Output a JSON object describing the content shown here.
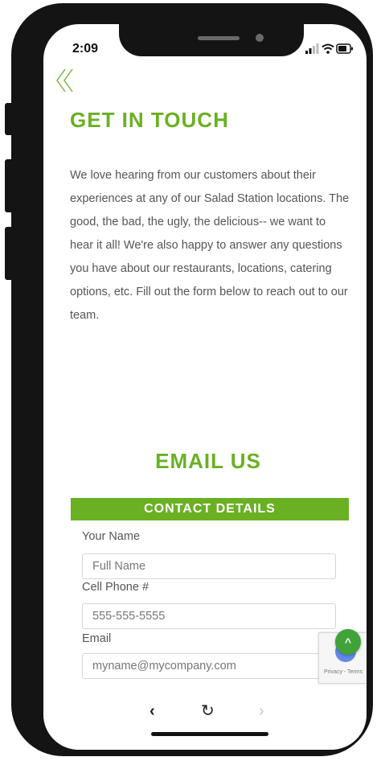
{
  "status_bar": {
    "time": "2:09",
    "icons": [
      "signal-icon",
      "wifi-icon",
      "battery-icon"
    ]
  },
  "nav": {
    "back_icon": "double-chevron-left-icon"
  },
  "intro": {
    "title": "GET IN TOUCH",
    "body": "We love hearing from our customers about their experiences at any of our Salad Station locations. The good, the bad, the ugly, the delicious-- we want to hear it all! We're also happy to answer any questions you have about our restaurants, locations, catering options, etc. Fill out the form below to reach out to our team."
  },
  "email_section": {
    "title": "EMAIL US",
    "banner": "CONTACT DETAILS"
  },
  "form": {
    "name_label": "Your Name",
    "name_placeholder": "Full Name",
    "phone_label": "Cell Phone #",
    "phone_placeholder": "555-555-5555",
    "email_label": "Email",
    "email_placeholder": "myname@mycompany.com"
  },
  "recaptcha": {
    "text": "Privacy - Terms"
  },
  "scroll_top": {
    "icon": "chevron-up-icon",
    "glyph": "^"
  },
  "browser_toolbar": {
    "back_glyph": "‹",
    "reload_glyph": "↻",
    "forward_glyph": "›"
  },
  "colors": {
    "accent": "#6ab023",
    "scroll_top": "#3fa33a",
    "text": "#555555"
  }
}
